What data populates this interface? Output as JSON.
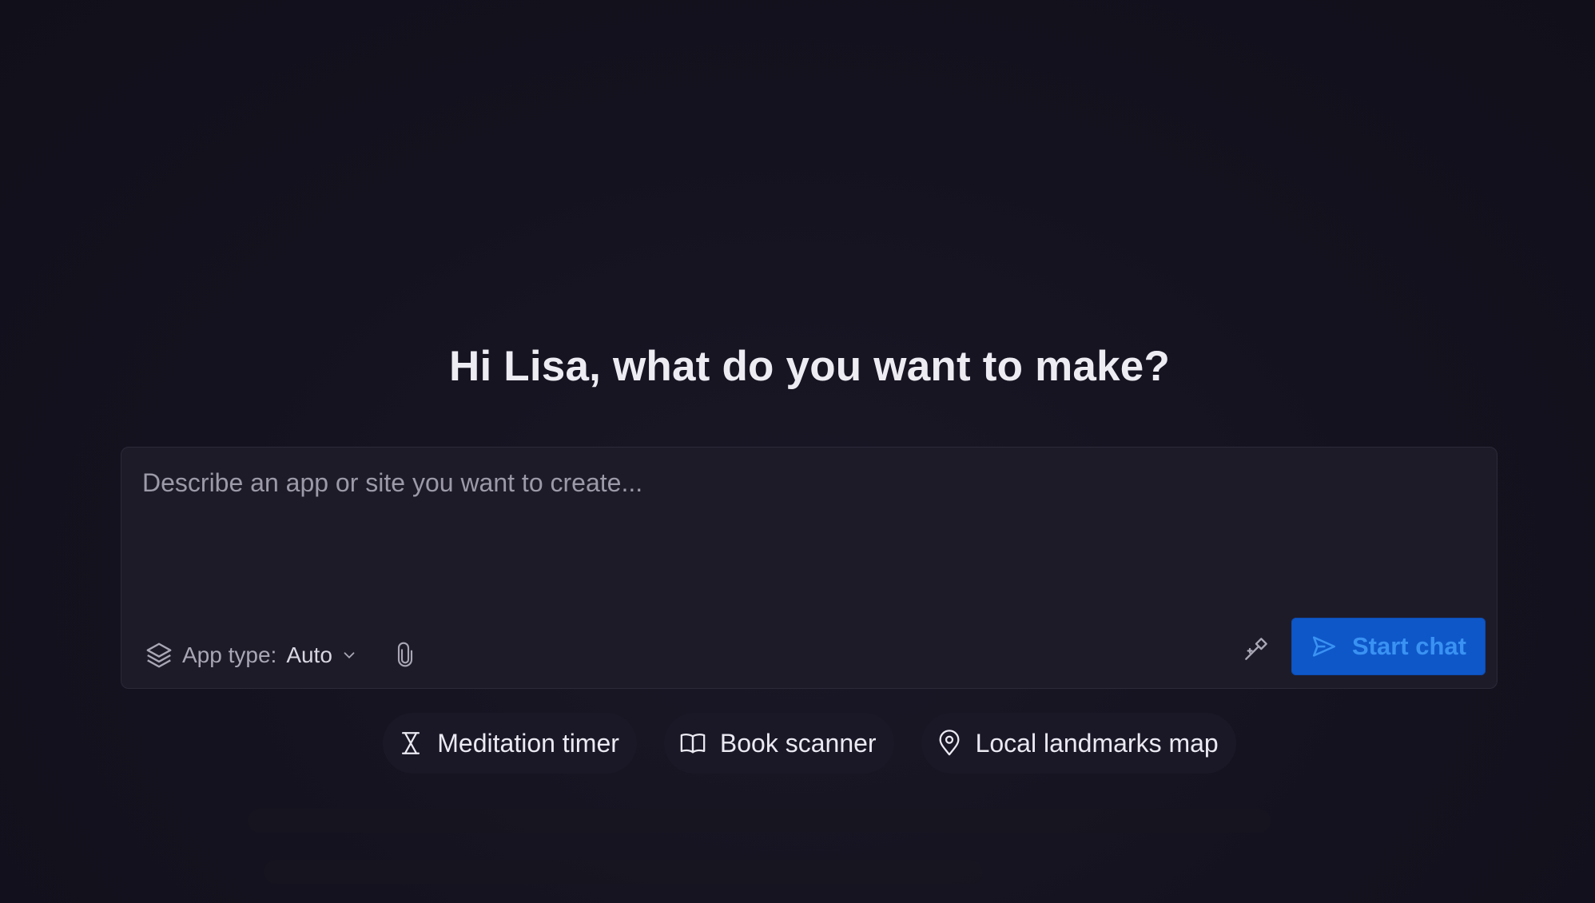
{
  "heading": "Hi Lisa, what do you want to make?",
  "composer": {
    "placeholder": "Describe an app or site you want to create...",
    "app_type_label": "App type:",
    "app_type_value": "Auto",
    "start_label": "Start chat"
  },
  "suggestions": [
    {
      "label": "Meditation timer",
      "icon": "hourglass-icon"
    },
    {
      "label": "Book scanner",
      "icon": "book-icon"
    },
    {
      "label": "Local landmarks map",
      "icon": "map-pin-icon"
    }
  ],
  "colors": {
    "background": "#13111d",
    "composer": "#1e1b29",
    "accent": "#0e57c9",
    "accent_text": "#3a92f2"
  }
}
